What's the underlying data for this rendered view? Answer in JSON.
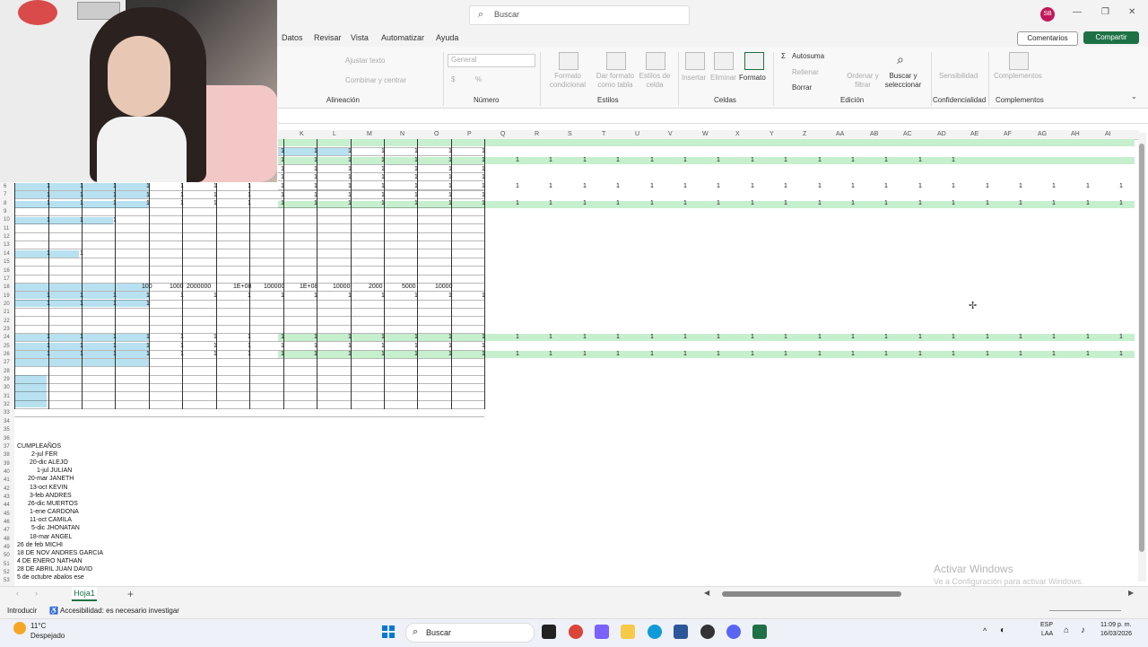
{
  "titlebar": {
    "search_placeholder": "Buscar",
    "avatar_initials": "SB"
  },
  "ribbon_tabs": [
    "Datos",
    "Revisar",
    "Vista",
    "Automatizar",
    "Ayuda"
  ],
  "buttons": {
    "comments": "Comentarios",
    "share": "Compartir"
  },
  "ribbon": {
    "wrap_text": "Ajustar texto",
    "merge_center": "Combinar y centrar",
    "alignment_group": "Alineación",
    "number_format": "General",
    "number_group": "Número",
    "conditional_format": "Formato condicional",
    "format_table": "Dar formato como tabla",
    "cell_styles": "Estilos de celda",
    "styles_group": "Estilos",
    "insert": "Insertar",
    "delete": "Eliminar",
    "format": "Formato",
    "cells_group": "Celdas",
    "autosum": "Autosuma",
    "fill": "Rellenar",
    "clear": "Borrar",
    "sort_filter": "Ordenar y filtrar",
    "find_select": "Buscar y seleccionar",
    "editing_group": "Edición",
    "sensitivity": "Sensibilidad",
    "sensitivity_group": "Confidencialidad",
    "addins": "Complementos",
    "addins_group": "Complementos"
  },
  "columns": [
    "K",
    "L",
    "M",
    "N",
    "O",
    "P",
    "Q",
    "R",
    "S",
    "T",
    "U",
    "V",
    "W",
    "X",
    "Y",
    "Z",
    "AA",
    "AB",
    "AC",
    "AD",
    "AE",
    "AF",
    "AG",
    "AH",
    "AI"
  ],
  "row_numbers": [
    "6",
    "7",
    "8",
    "9",
    "10",
    "11",
    "12",
    "13",
    "14",
    "15",
    "16",
    "17",
    "18",
    "19",
    "20",
    "21",
    "22",
    "23",
    "24",
    "25",
    "26",
    "27",
    "28",
    "29",
    "30",
    "31",
    "32",
    "33",
    "34",
    "35",
    "36",
    "37",
    "38",
    "39",
    "40",
    "41",
    "42",
    "43",
    "44",
    "45",
    "46",
    "47",
    "48",
    "49",
    "50",
    "51",
    "52",
    "53"
  ],
  "row18_values": [
    "100",
    "1000",
    "2000000",
    "1E+08",
    "100000",
    "1E+08",
    "10000",
    "2000",
    "5000",
    "10000"
  ],
  "cell_one": "1",
  "birthdays_title": "CUMPLEAÑOS",
  "birthdays": [
    "2-jul FER",
    "20-dic ALEJO",
    "1-jul JULIAN",
    "20-mar JANETH",
    "13-oct KEVIN",
    "3-feb ANDRES",
    "26-dic MUERTOS",
    "1-ene CARDONA",
    "11-oct CAMILA",
    "5-dic JHONATAN",
    "18-mar ANGEL",
    "26 de feb MICHI",
    "18 DE NOV ANDRES GARCIA",
    "4 DE ENERO NATHAN",
    "28 DE ABRIL JUAN DAVID",
    "5 de octubre abalos ese"
  ],
  "sheet_tab": "Hoja1",
  "status": {
    "mode": "Introducir",
    "accessibility": "Accesibilidad: es necesario investigar"
  },
  "watermark": {
    "line1": "Activar Windows",
    "line2": "Ve a Configuración para activar Windows."
  },
  "taskbar": {
    "weather_temp": "11°C",
    "weather_desc": "Despejado",
    "search_label": "Buscar",
    "lang1": "ESP",
    "lang2": "LAA",
    "time": "11:09 p. m.",
    "date": "16/03/2026"
  }
}
